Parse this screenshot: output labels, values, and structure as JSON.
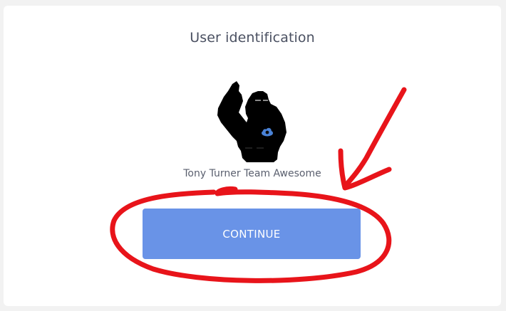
{
  "card": {
    "title": "User identification",
    "user": {
      "name": "Tony Turner Team Awesome",
      "avatar_icon": "ninja-avatar-icon"
    },
    "continue_label": "CONTINUE"
  },
  "colors": {
    "background": "#f2f2f2",
    "card": "#ffffff",
    "button": "#6993e7",
    "annotation": "#e8141a"
  }
}
